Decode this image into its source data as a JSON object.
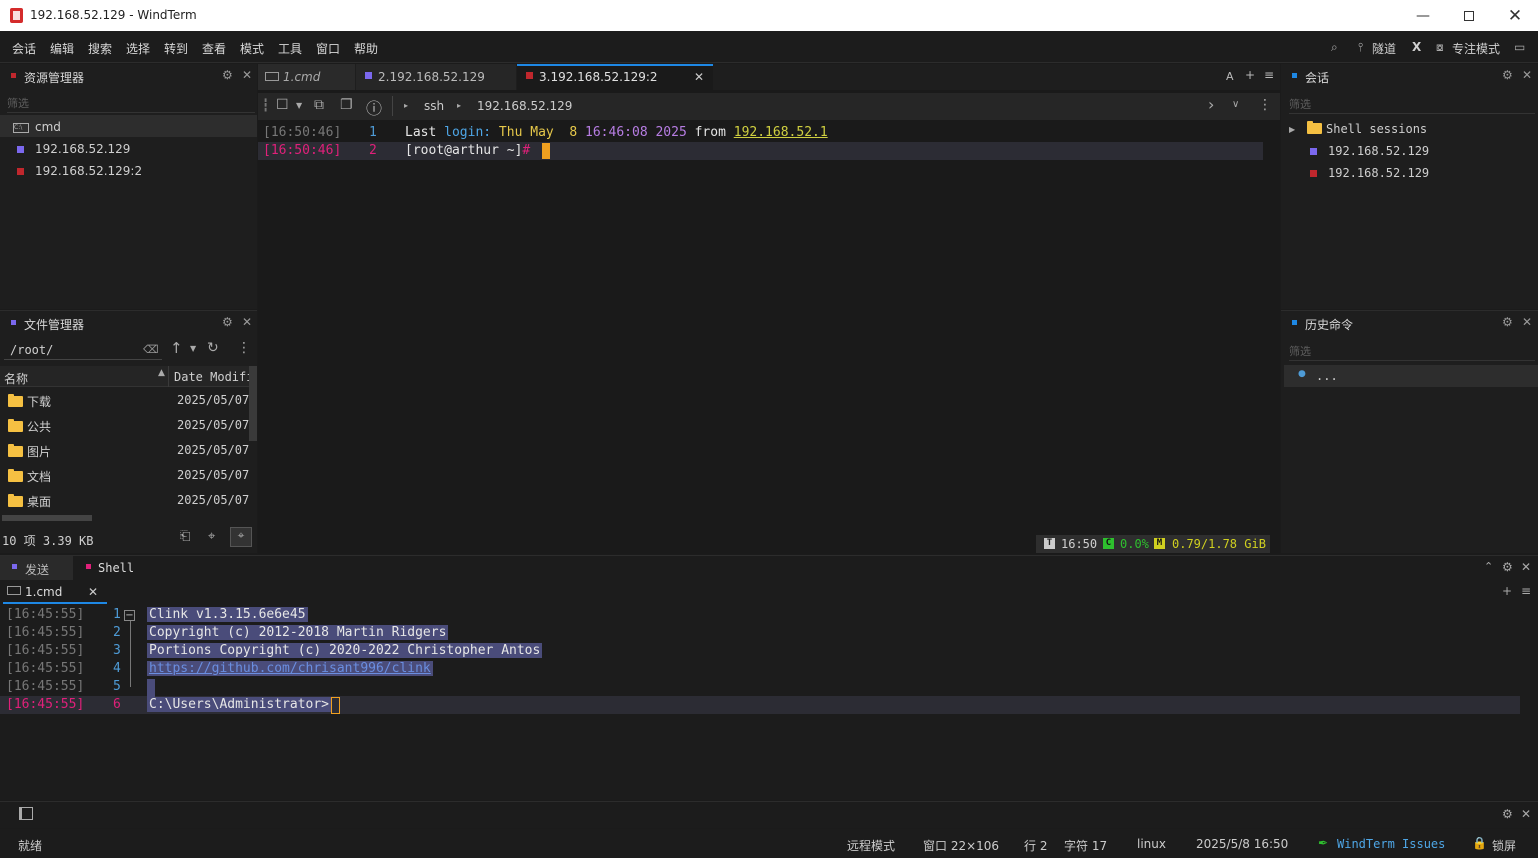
{
  "window": {
    "title": "192.168.52.129 - WindTerm"
  },
  "menu": [
    "会话",
    "编辑",
    "搜索",
    "选择",
    "转到",
    "查看",
    "模式",
    "工具",
    "窗口",
    "帮助"
  ],
  "menu_right": {
    "tunnel": "隧道",
    "x": "X",
    "focus": "专注模式"
  },
  "explorer": {
    "title": "资源管理器",
    "filter": "筛选",
    "items": [
      {
        "label": "cmd",
        "color": ""
      },
      {
        "label": "192.168.52.129",
        "color": "#7b68ee"
      },
      {
        "label": "192.168.52.129:2",
        "color": "#c0272d"
      }
    ]
  },
  "file_manager": {
    "title": "文件管理器",
    "path": "/root/",
    "col_name": "名称",
    "col_date": "Date Modifi",
    "rows": [
      {
        "name": "下载",
        "date": "2025/05/07"
      },
      {
        "name": "公共",
        "date": "2025/05/07"
      },
      {
        "name": "图片",
        "date": "2025/05/07"
      },
      {
        "name": "文档",
        "date": "2025/05/07"
      },
      {
        "name": "桌面",
        "date": "2025/05/07"
      }
    ],
    "status": "10 项 3.39 KB"
  },
  "tabs": [
    {
      "label": "1.cmd",
      "color": ""
    },
    {
      "label": "2.192.168.52.129",
      "color": "#7b68ee"
    },
    {
      "label": "3.192.168.52.129:2",
      "color": "#c0272d"
    }
  ],
  "tab_right": {
    "font": "A",
    "add": "+",
    "menu": "≡"
  },
  "breadcrumb": {
    "proto": "ssh",
    "host": "192.168.52.129"
  },
  "terminal": {
    "lines": [
      {
        "time": "[16:50:46]",
        "num": "1",
        "parts": [
          "Last ",
          "login:",
          " Thu May  8 ",
          "16:46:08 2025",
          " from ",
          "192.168.52.1"
        ]
      },
      {
        "time": "[16:50:46]",
        "num": "2",
        "prompt": "[root@arthur ~]",
        "hash": "#"
      }
    ],
    "status": {
      "time": "16:50",
      "cpu": "0.0%",
      "mem": "0.79/1.78 GiB"
    }
  },
  "sessions": {
    "title": "会话",
    "filter": "筛选",
    "group": "Shell sessions",
    "items": [
      {
        "label": "192.168.52.129",
        "color": "#7b68ee"
      },
      {
        "label": "192.168.52.129",
        "color": "#c0272d"
      }
    ]
  },
  "history": {
    "title": "历史命令",
    "filter": "筛选",
    "item": "..."
  },
  "bottom_tabs": [
    {
      "label": "发送",
      "color": "#7b68ee"
    },
    {
      "label": "Shell",
      "color": "#e0207a"
    }
  ],
  "bottom_session": {
    "label": "1.cmd"
  },
  "bottom_lines": [
    {
      "time": "[16:45:55]",
      "num": "1",
      "text": "Clink v1.3.15.6e6e45"
    },
    {
      "time": "[16:45:55]",
      "num": "2",
      "text": "Copyright (c) 2012-2018 Martin Ridgers"
    },
    {
      "time": "[16:45:55]",
      "num": "3",
      "text": "Portions Copyright (c) 2020-2022 Christopher Antos"
    },
    {
      "time": "[16:45:55]",
      "num": "4",
      "text": "https://github.com/chrisant996/clink"
    },
    {
      "time": "[16:45:55]",
      "num": "5",
      "text": ""
    },
    {
      "time": "[16:45:55]",
      "num": "6",
      "text": "C:\\Users\\Administrator>"
    }
  ],
  "statusbar": {
    "ready": "就绪",
    "mode": "远程模式",
    "window": "窗口 22×106",
    "row": "行 2",
    "col": "字符 17",
    "os": "linux",
    "datetime": "2025/5/8 16:50",
    "issues": "WindTerm Issues",
    "lock": "锁屏"
  },
  "colors": {
    "accent": "#1e88e5",
    "tab_active": "#1e88e5",
    "selection": "#4a4c7a",
    "prompt_hash": "#e0207a",
    "timestamp_active": "#e0207a"
  }
}
